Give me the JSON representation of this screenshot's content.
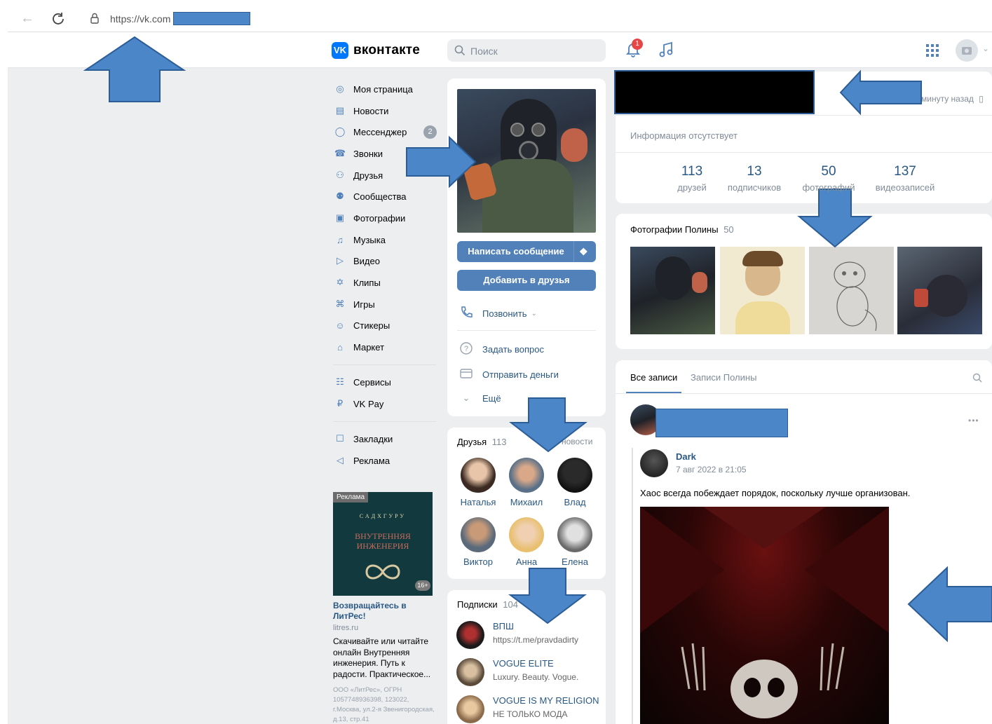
{
  "browser": {
    "url": "https://vk.com"
  },
  "header": {
    "logo_text": "вконтакте",
    "logo_letter": "VK",
    "search_placeholder": "Поиск",
    "notification_count": "1"
  },
  "menu": {
    "items": [
      {
        "label": "Моя страница",
        "icon": "user-circle-icon"
      },
      {
        "label": "Новости",
        "icon": "newspaper-icon"
      },
      {
        "label": "Мессенджер",
        "icon": "message-icon",
        "badge": "2"
      },
      {
        "label": "Звонки",
        "icon": "phone-icon"
      },
      {
        "label": "Друзья",
        "icon": "friends-icon"
      },
      {
        "label": "Сообщества",
        "icon": "communities-icon"
      },
      {
        "label": "Фотографии",
        "icon": "photo-icon"
      },
      {
        "label": "Музыка",
        "icon": "music-icon"
      },
      {
        "label": "Видео",
        "icon": "video-icon"
      },
      {
        "label": "Клипы",
        "icon": "clips-icon"
      },
      {
        "label": "Игры",
        "icon": "gamepad-icon"
      },
      {
        "label": "Стикеры",
        "icon": "sticker-icon"
      },
      {
        "label": "Маркет",
        "icon": "market-icon"
      },
      {
        "label": "Сервисы",
        "icon": "services-icon"
      },
      {
        "label": "VK Pay",
        "icon": "vkpay-icon"
      },
      {
        "label": "Закладки",
        "icon": "bookmark-icon"
      },
      {
        "label": "Реклама",
        "icon": "megaphone-icon"
      }
    ]
  },
  "ad": {
    "tag": "Реклама",
    "book_title": "ВНУТРЕННЯЯ ИНЖЕНЕРИЯ",
    "book_author": "САДХГУРУ",
    "age": "16+",
    "title": "Возвращайтесь в ЛитРес!",
    "domain": "litres.ru",
    "text": "Скачивайте или читайте онлайн Внутренняя инженерия. Путь к радости. Практическое...",
    "legal": "ООО «ЛитРес», ОГРН 1057748936398, 123022, г.Москва, ул.2-я Звенигородская, д.13, стр.41"
  },
  "profile": {
    "write_message": "Написать сообщение",
    "add_friend": "Добавить в друзья",
    "call": "Позвонить",
    "ask_question": "Задать вопрос",
    "send_money": "Отправить деньги",
    "more": "Ещё",
    "last_seen": "минуту назад",
    "info_missing": "Информация отсутствует",
    "stats": [
      {
        "num": "113",
        "label": "друзей"
      },
      {
        "num": "13",
        "label": "подписчиков"
      },
      {
        "num": "50",
        "label": "фотографий"
      },
      {
        "num": "137",
        "label": "видеозаписей"
      }
    ]
  },
  "friends": {
    "title": "Друзья",
    "count": "113",
    "updates": "новости",
    "list": [
      "Наталья",
      "Михаил",
      "Влад",
      "Виктор",
      "Анна",
      "Елена"
    ]
  },
  "subscriptions": {
    "title": "Подписки",
    "count": "104",
    "list": [
      {
        "name": "ВПШ",
        "desc": "https://t.me/pravdadirty"
      },
      {
        "name": "VOGUE ELITE",
        "desc": "Luxury. Beauty. Vogue."
      },
      {
        "name": "VOGUE IS MY RELIGION",
        "desc": "НЕ ТОЛЬКО МОДА"
      }
    ]
  },
  "photos": {
    "title": "Фотографии Полины",
    "count": "50"
  },
  "wall": {
    "tab_all": "Все записи",
    "tab_own": "Записи Полины",
    "repost_author": "Dark",
    "repost_date": "7 авг 2022 в 21:05",
    "post_text": "Хаос всегда побеждает порядок, поскольку лучше организован.",
    "menu_dots": "•••"
  },
  "colors": {
    "accent": "#5181b8",
    "link": "#2a5885",
    "background": "#edeef0",
    "annotation_arrow": "#4a86c8"
  }
}
